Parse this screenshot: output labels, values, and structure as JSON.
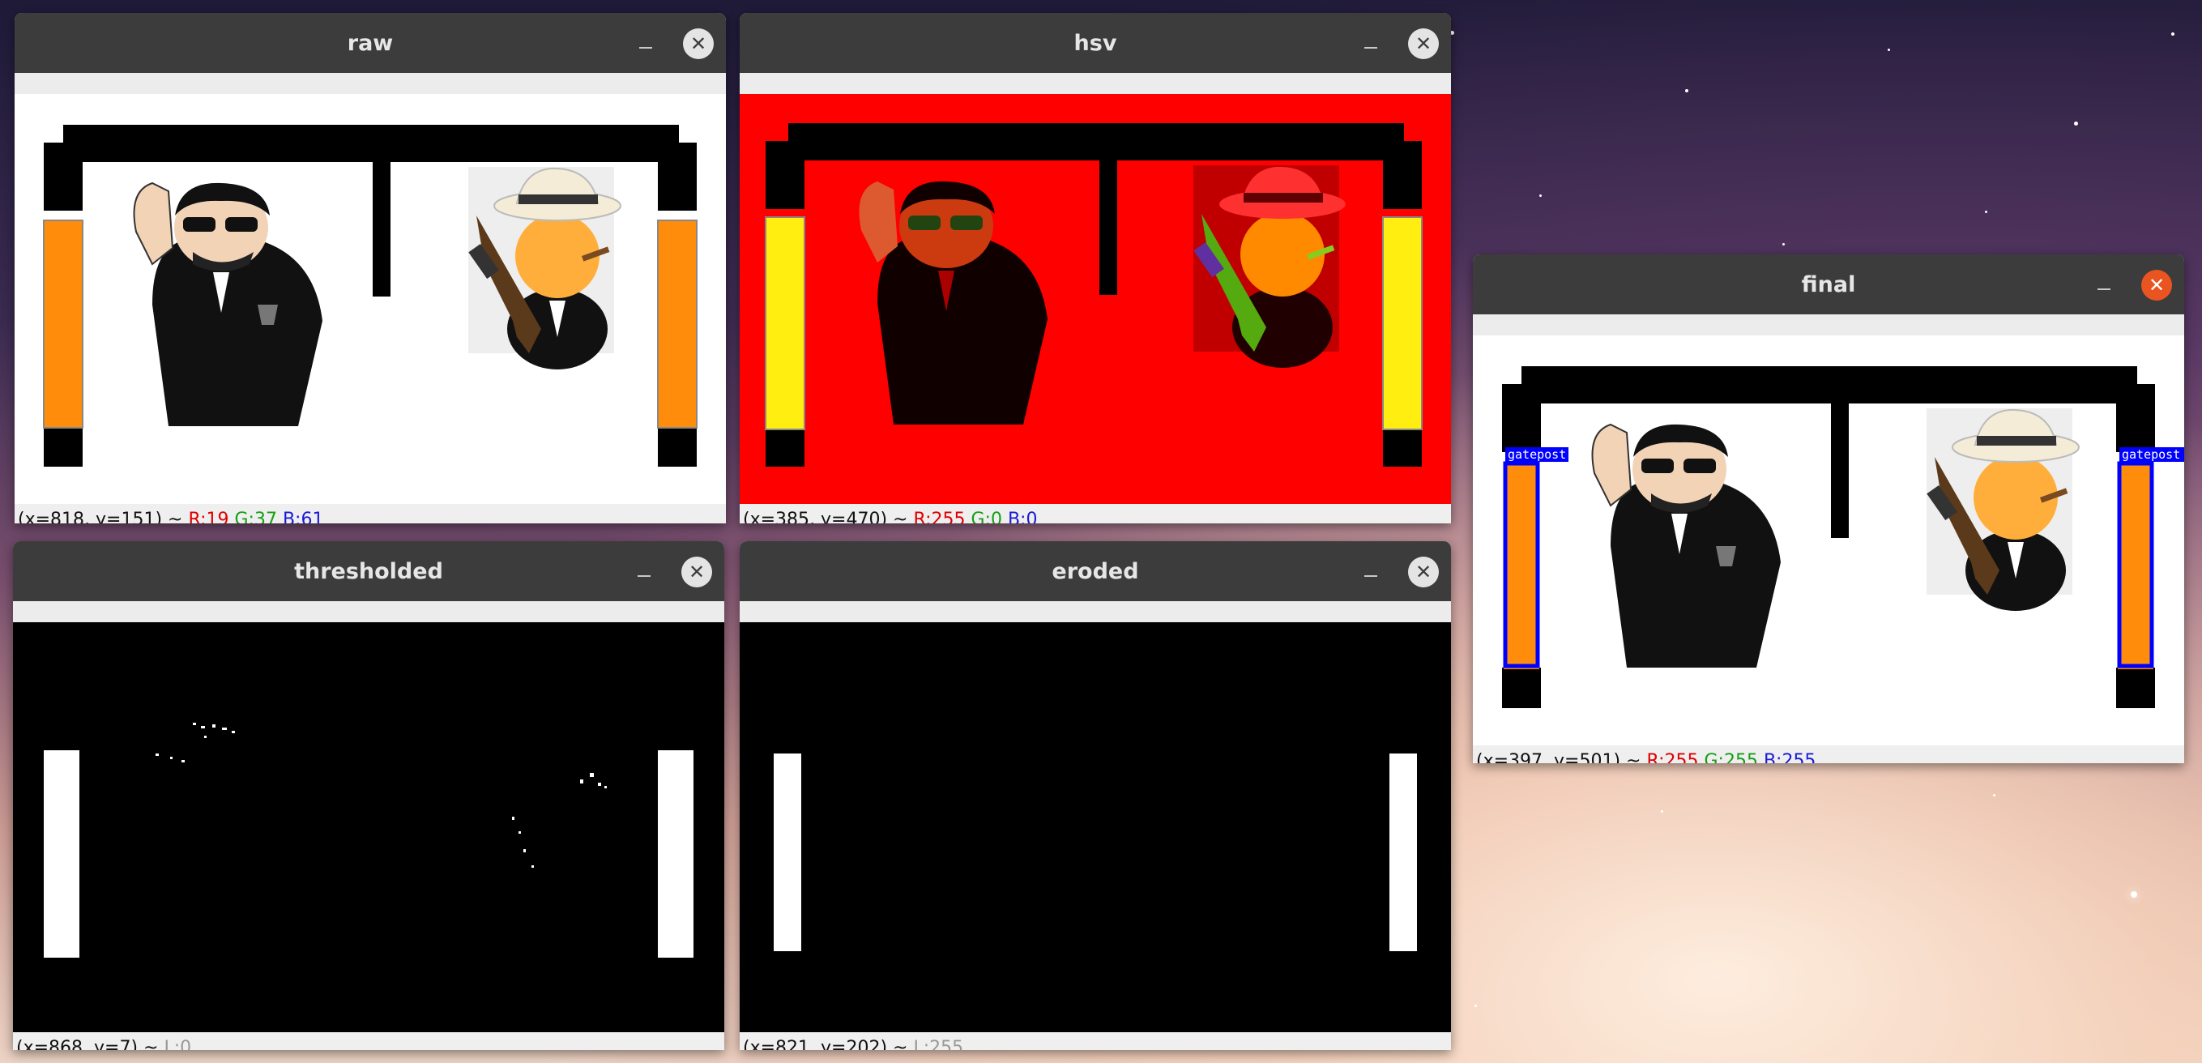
{
  "windows": {
    "raw": {
      "title": "raw",
      "status": {
        "coords": "(x=818, y=151) ~",
        "r": "R:19",
        "g": "G:37",
        "b": "B:61"
      }
    },
    "hsv": {
      "title": "hsv",
      "status": {
        "coords": "(x=385, y=470) ~",
        "r": "R:255",
        "g": "G:0",
        "b": "B:0"
      }
    },
    "thresholded": {
      "title": "thresholded",
      "status": {
        "coords": "(x=868, y=7) ~",
        "l": "L:0"
      }
    },
    "eroded": {
      "title": "eroded",
      "status": {
        "coords": "(x=821, y=202) ~",
        "l": "L:255"
      }
    },
    "final": {
      "title": "final",
      "status": {
        "coords": "(x=397, y=501) ~",
        "r": "R:255",
        "g": "G:255",
        "b": "B:255"
      },
      "labels": {
        "left": "gatepost",
        "right": "gatepost"
      }
    }
  },
  "icons": {
    "minimize": "minimize-icon",
    "close": "close-icon"
  },
  "colors": {
    "titlebar": "#3c3c3c",
    "orange_post": "#ff8c0a",
    "yellow_post": "#ffee10",
    "hsv_background": "#ff0000",
    "detection_box": "#0000ff",
    "active_close": "#e95420"
  }
}
